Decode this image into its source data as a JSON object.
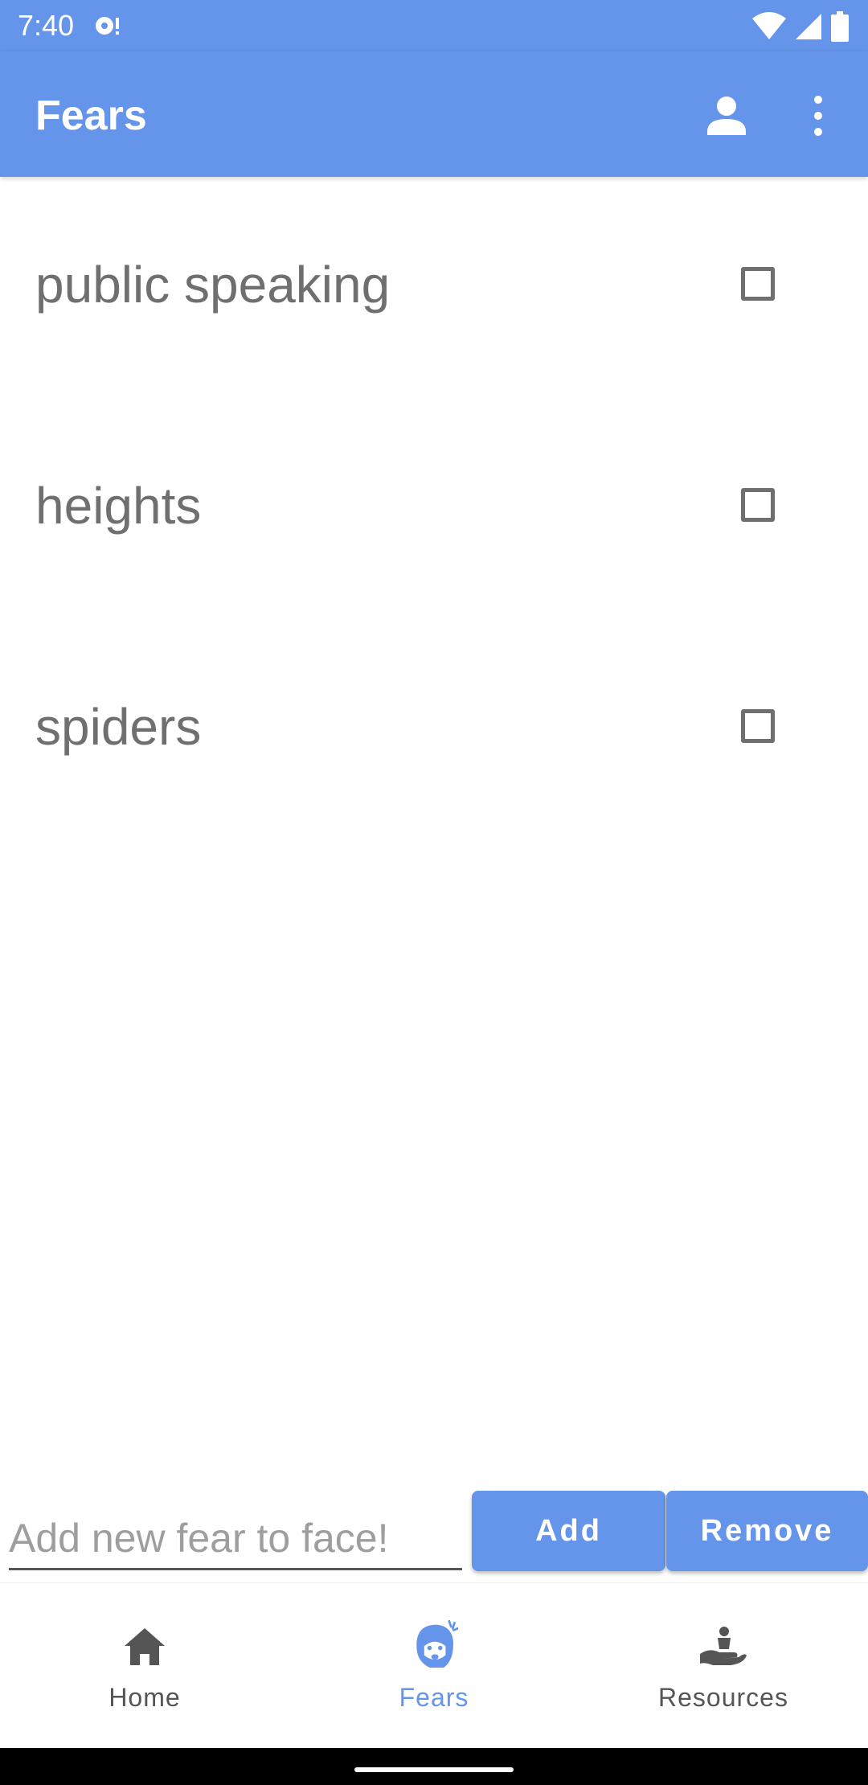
{
  "status_bar": {
    "time": "7:40",
    "icons": [
      "notification-icon",
      "wifi-icon",
      "signal-icon",
      "battery-icon"
    ]
  },
  "app_bar": {
    "title": "Fears",
    "icons": [
      "account-icon",
      "overflow-menu-icon"
    ],
    "color": "#6495ea"
  },
  "fears": [
    {
      "label": "public speaking",
      "checked": false
    },
    {
      "label": "heights",
      "checked": false
    },
    {
      "label": "spiders",
      "checked": false
    }
  ],
  "input": {
    "placeholder": "Add new fear to face!",
    "value": ""
  },
  "buttons": {
    "add": "Add",
    "remove": "Remove"
  },
  "bottom_nav": {
    "items": [
      {
        "label": "Home",
        "icon": "home-icon",
        "selected": false
      },
      {
        "label": "Fears",
        "icon": "scared-face-icon",
        "selected": true
      },
      {
        "label": "Resources",
        "icon": "hand-heart-icon",
        "selected": false
      }
    ],
    "selected_color": "#6495ea",
    "unselected_color": "#555555"
  }
}
